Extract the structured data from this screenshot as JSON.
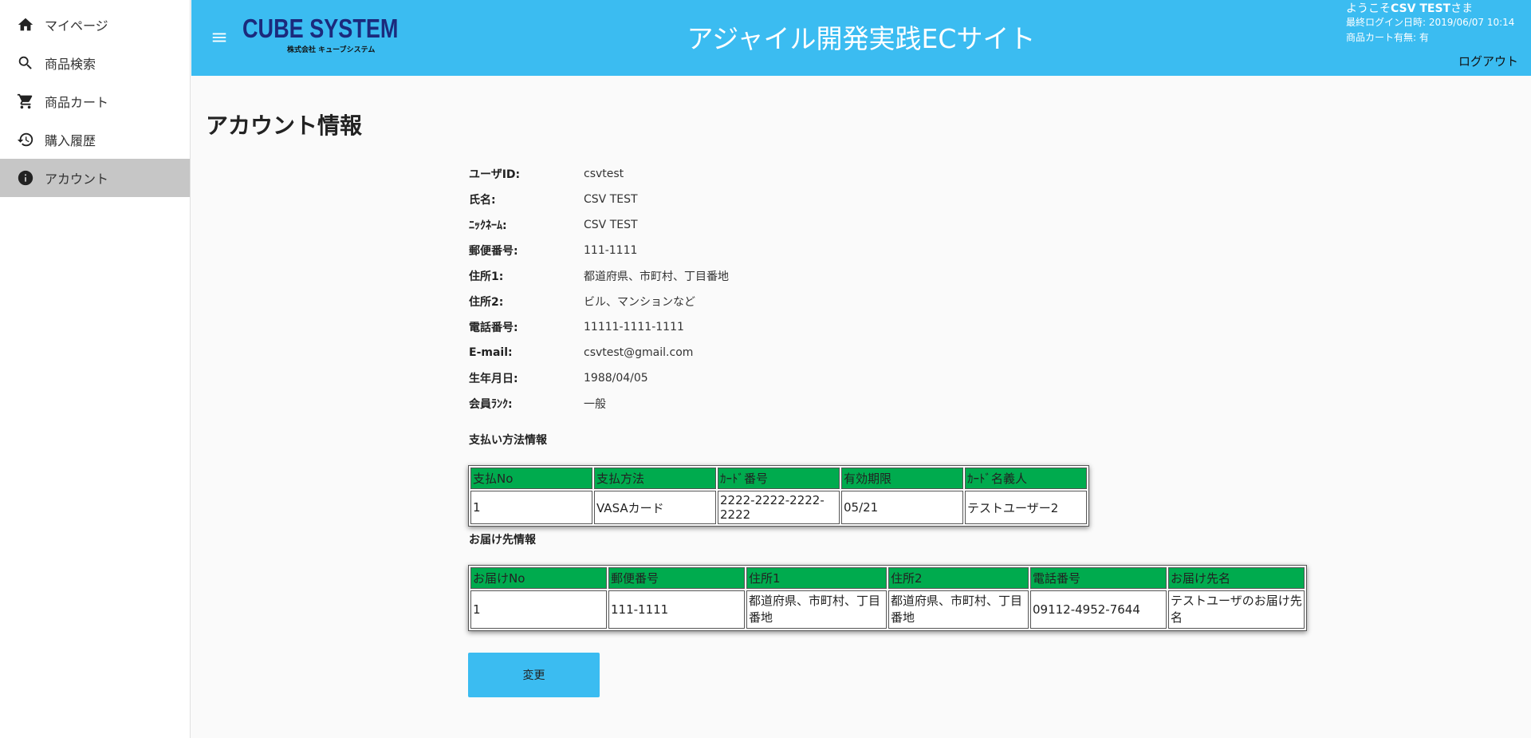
{
  "sidebar": {
    "items": [
      {
        "label": "マイページ",
        "icon": "home-icon"
      },
      {
        "label": "商品検索",
        "icon": "search-icon"
      },
      {
        "label": "商品カート",
        "icon": "cart-icon"
      },
      {
        "label": "購入履歴",
        "icon": "history-icon"
      },
      {
        "label": "アカウント",
        "icon": "info-icon",
        "active": true
      }
    ]
  },
  "header": {
    "logo_main": "CUBE SYSTEM",
    "logo_sub": "株式会社 キューブシステム",
    "title": "アジャイル開発実践ECサイト",
    "welcome_prefix": "ようこそ",
    "welcome_name": "CSV TEST",
    "welcome_suffix": "さま",
    "last_login": "最終ログイン日時: 2019/06/07 10:14",
    "cart_status": "商品カート有無: 有",
    "logout": "ログアウト",
    "color": "#3bbcf1"
  },
  "page": {
    "title": "アカウント情報"
  },
  "account": {
    "rows": [
      {
        "label": "ユーザID:",
        "value": "csvtest"
      },
      {
        "label": "氏名:",
        "value": "CSV TEST"
      },
      {
        "label": "ﾆｯｸﾈｰﾑ:",
        "value": "CSV TEST"
      },
      {
        "label": "郵便番号:",
        "value": "111-1111"
      },
      {
        "label": "住所1:",
        "value": "都道府県、市町村、丁目番地"
      },
      {
        "label": "住所2:",
        "value": "ビル、マンションなど"
      },
      {
        "label": "電話番号:",
        "value": "11111-1111-1111"
      },
      {
        "label": "E-mail:",
        "value": "csvtest@gmail.com"
      },
      {
        "label": "生年月日:",
        "value": "1988/04/05"
      },
      {
        "label": "会員ﾗﾝｸ:",
        "value": "一般"
      }
    ]
  },
  "payment": {
    "section_title": "支払い方法情報",
    "headers": [
      "支払No",
      "支払方法",
      "ｶｰﾄﾞ番号",
      "有効期限",
      "ｶｰﾄﾞ名義人"
    ],
    "rows": [
      [
        "1",
        "VASAカード",
        "2222-2222-2222-2222",
        "05/21",
        "テストユーザー2"
      ]
    ]
  },
  "delivery": {
    "section_title": "お届け先情報",
    "headers": [
      "お届けNo",
      "郵便番号",
      "住所1",
      "住所2",
      "電話番号",
      "お届け先名"
    ],
    "rows": [
      [
        "1",
        "111-1111",
        "都道府県、市町村、丁目番地",
        "都道府県、市町村、丁目番地",
        "09112-4952-7644",
        "テストユーザのお届け先名"
      ]
    ]
  },
  "actions": {
    "change_label": "変更"
  },
  "colors": {
    "table_header": "#00ab4e",
    "accent": "#3bbcf1",
    "active_nav": "#c6c6c6"
  }
}
